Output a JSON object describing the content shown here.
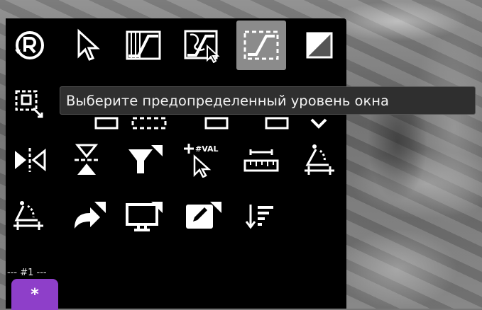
{
  "toolbar": {
    "tooltip": "Выберите предопределенный уровень окна",
    "group_label": "--- #1 ---",
    "preset_button_label": "*",
    "colors": {
      "panel": "#000000",
      "active_tool": "#8b8b8b",
      "preset_button": "#8e3fc9",
      "tooltip_bg": "#2f2f2f",
      "icon": "#ffffff"
    },
    "value_glyph": "#VAL",
    "tools": [
      {
        "icon": "reset-r-icon",
        "active": false
      },
      {
        "icon": "arrow-pointer-icon",
        "active": false
      },
      {
        "icon": "window-level-icon",
        "active": false
      },
      {
        "icon": "window-level-mouse-icon",
        "active": false
      },
      {
        "icon": "preset-window-level-icon",
        "active": true
      },
      {
        "icon": "invert-icon",
        "active": false
      },
      {
        "icon": "zoom-region-icon",
        "active": false
      },
      {
        "icon": "flip-horizontal-icon",
        "active": false
      },
      {
        "icon": "flip-vertical-icon",
        "active": false
      },
      {
        "icon": "filter-icon",
        "active": false
      },
      {
        "icon": "pixel-value-icon",
        "active": false
      },
      {
        "icon": "ruler-icon",
        "active": false
      },
      {
        "icon": "angle-icon",
        "active": false
      },
      {
        "icon": "cobb-angle-icon",
        "active": false
      },
      {
        "icon": "redo-share-icon",
        "active": false
      },
      {
        "icon": "monitor-icon",
        "active": false
      },
      {
        "icon": "annotate-pencil-icon",
        "active": false
      },
      {
        "icon": "sort-order-icon",
        "active": false
      }
    ]
  }
}
